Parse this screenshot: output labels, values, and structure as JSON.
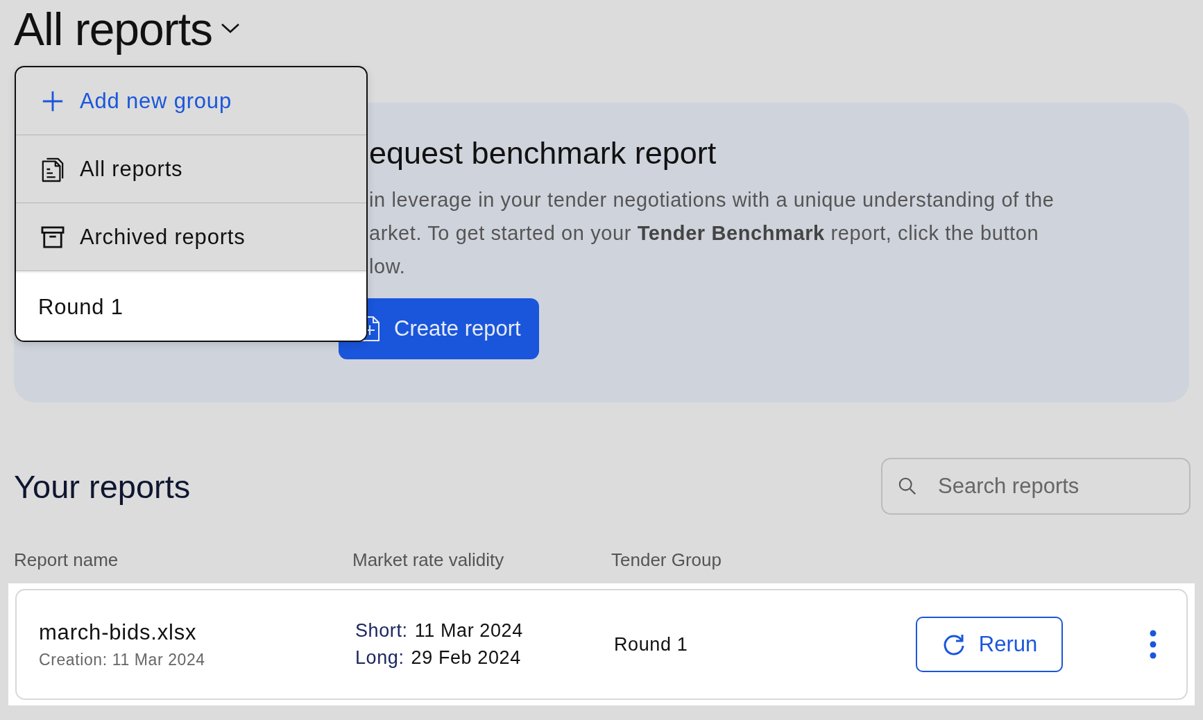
{
  "title": "All reports",
  "menu": [
    {
      "label": "Add new group",
      "kind": "add",
      "selected": false
    },
    {
      "label": "All reports",
      "kind": "all",
      "selected": false
    },
    {
      "label": "Archived reports",
      "kind": "archive",
      "selected": false
    },
    {
      "label": "Round 1",
      "kind": "group",
      "selected": true
    }
  ],
  "banner": {
    "heading": "equest benchmark report",
    "lines": [
      "in leverage in your tender negotiations with a unique understanding of the",
      "arket. To get started on your **Tender Benchmark** report, click the button",
      "low."
    ],
    "button": "Create report"
  },
  "reports": {
    "heading": "Your reports",
    "search": {
      "placeholder": "Search reports"
    },
    "columns": [
      "Report name",
      "Market rate validity",
      "Tender Group"
    ],
    "rows": [
      {
        "name": "march-bids.xlsx",
        "creation": "Creation: 11 Mar 2024",
        "short_label": "Short:",
        "short": "11 Mar 2024",
        "long_label": "Long:",
        "long": "29 Feb 2024",
        "group": "Round 1",
        "action": "Rerun"
      }
    ]
  }
}
